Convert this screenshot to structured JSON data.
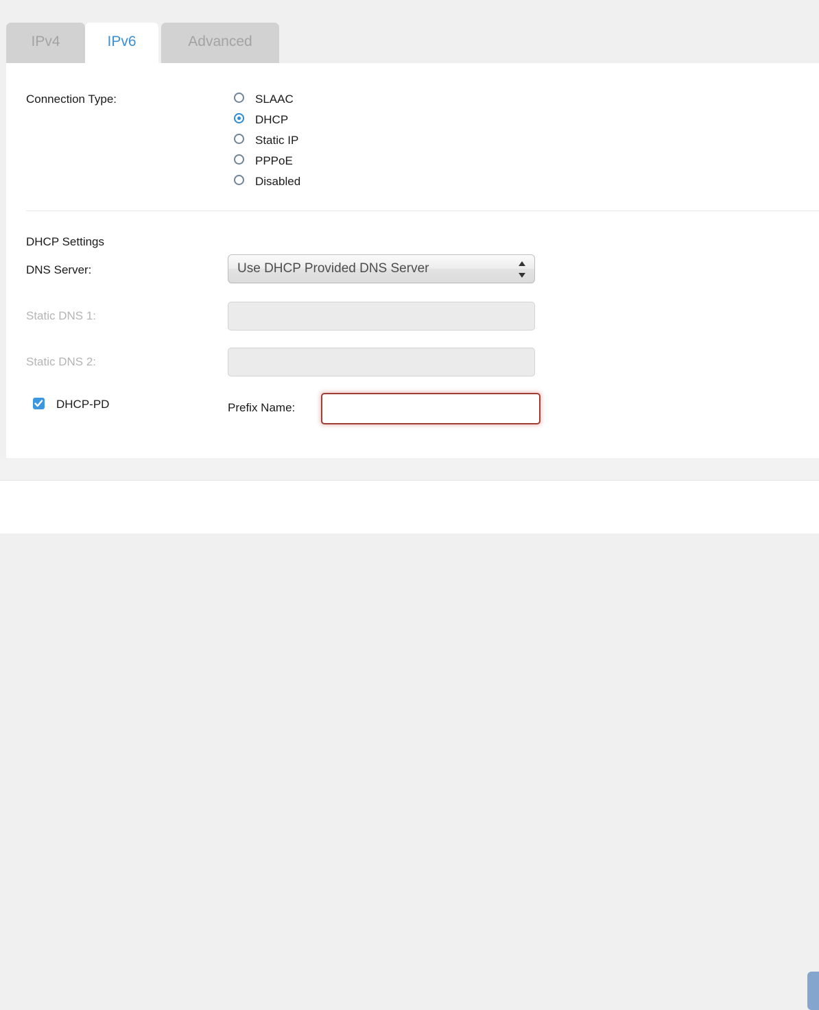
{
  "tabs": [
    {
      "id": "ipv4",
      "label": "IPv4",
      "active": false
    },
    {
      "id": "ipv6",
      "label": "IPv6",
      "active": true
    },
    {
      "id": "advanced",
      "label": "Advanced",
      "active": false
    }
  ],
  "connection_type": {
    "label": "Connection Type:",
    "selected": "DHCP",
    "options": [
      {
        "label": "SLAAC",
        "checked": false
      },
      {
        "label": "DHCP",
        "checked": true
      },
      {
        "label": "Static IP",
        "checked": false
      },
      {
        "label": "PPPoE",
        "checked": false
      },
      {
        "label": "Disabled",
        "checked": false
      }
    ]
  },
  "dhcp_settings": {
    "section_title": "DHCP Settings",
    "dns_server": {
      "label": "DNS Server:",
      "selected": "Use DHCP Provided DNS Server"
    },
    "static_dns_1": {
      "label": "Static DNS 1:",
      "value": "",
      "placeholder": "",
      "disabled": true
    },
    "static_dns_2": {
      "label": "Static DNS 2:",
      "value": "",
      "placeholder": "",
      "disabled": true
    },
    "dhcp_pd": {
      "label": "DHCP-PD",
      "checked": true
    },
    "prefix_name": {
      "label": "Prefix Name:",
      "value": "",
      "placeholder": "",
      "error": true
    }
  },
  "colors": {
    "active_tab_text": "#3b8fd4",
    "inactive_tab_bg": "#d2d2d2",
    "inactive_tab_text": "#a3a3a3",
    "radio_selected": "#2b8ada",
    "radio_unselected": "#6f8496",
    "checkbox_fill": "#3b97e0",
    "error_border": "#a03c36",
    "footer_button": "#84a6ce",
    "page_bg": "#f0f0f0"
  }
}
